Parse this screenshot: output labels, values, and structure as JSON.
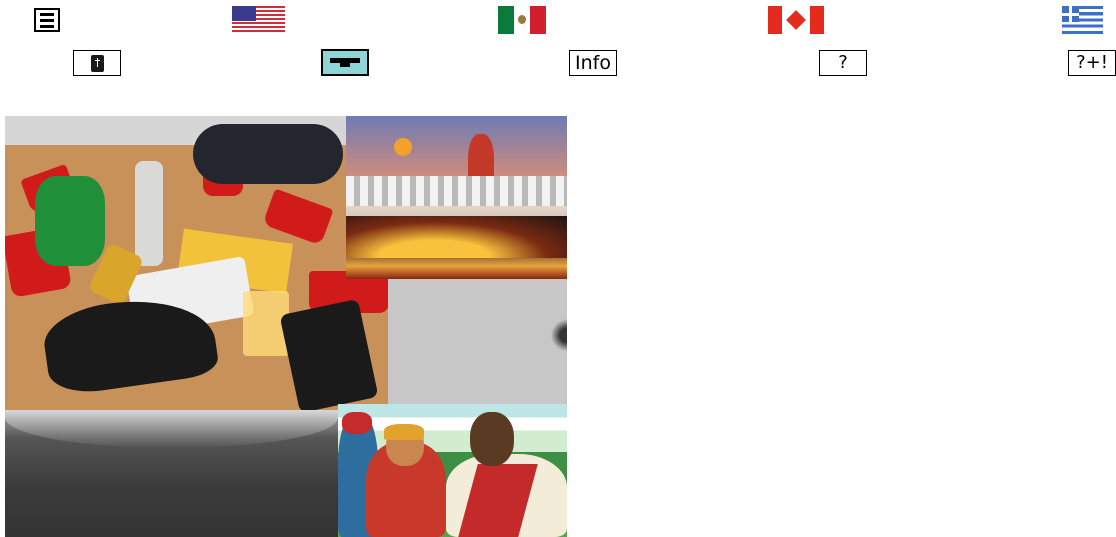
{
  "toolbar": {
    "menu_icon": "hamburger-menu-icon",
    "flags": [
      {
        "name": "us-flag",
        "colors": [
          "#d02d36",
          "#ffffff",
          "#3b3b8d"
        ]
      },
      {
        "name": "mexico-flag",
        "colors": [
          "#0b7a3b",
          "#ffffff",
          "#d11f2d"
        ]
      },
      {
        "name": "canada-flag",
        "colors": [
          "#e52b1e",
          "#ffffff"
        ]
      },
      {
        "name": "greece-flag",
        "colors": [
          "#3d6fc4",
          "#ffffff"
        ]
      }
    ]
  },
  "buttons": {
    "bible_icon": "bible-icon",
    "graduation_icon": "graduation-cap-icon",
    "info_label": "Info",
    "help_label": "?",
    "help_plus_label": "?+!"
  },
  "colors": {
    "active_button_bg": "#8fd4d6"
  }
}
